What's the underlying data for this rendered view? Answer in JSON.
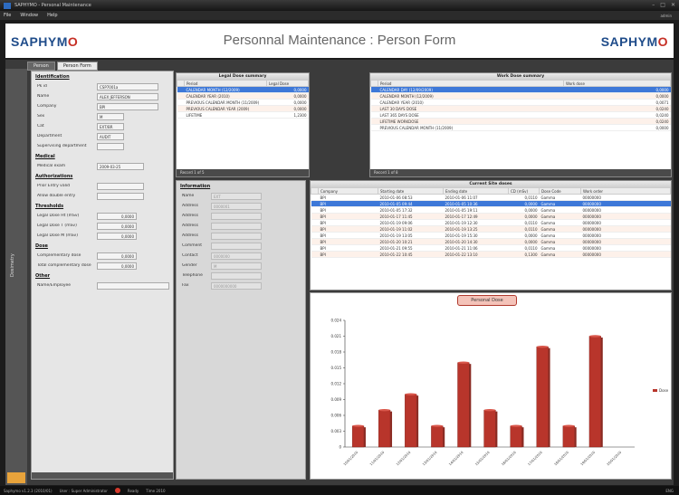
{
  "window": {
    "title": "SAPHYMO - Personal Maintenance",
    "menu": [
      "File",
      "Window",
      "Help"
    ],
    "user": "admin"
  },
  "header": {
    "logo": "SAPHYMO",
    "title": "Personnal Maintenance : Person Form"
  },
  "tabs": [
    "Person",
    "Person Form"
  ],
  "side_tab": "Dosimetry",
  "form": {
    "sections": [
      {
        "title": "Identification",
        "fields": [
          {
            "label": "Pk id",
            "value": "CSP7001a"
          },
          {
            "label": "Name",
            "value": "ALEX JEFFERSON"
          },
          {
            "label": "Company",
            "value": "BPI"
          },
          {
            "label": "Sex",
            "value": "M"
          },
          {
            "label": "Cat",
            "value": "EXT/BR"
          },
          {
            "label": "Department",
            "value": "AUDIT"
          },
          {
            "label": "Supervising department",
            "value": ""
          }
        ]
      },
      {
        "title": "Medical",
        "fields": [
          {
            "label": "Medical exam",
            "value": "2009-03-25"
          }
        ]
      },
      {
        "title": "Authorizations",
        "fields": [
          {
            "label": "Prior Entry valid",
            "value": ""
          },
          {
            "label": "Allow double entry",
            "value": ""
          }
        ]
      },
      {
        "title": "Thresholds",
        "fields": [
          {
            "label": "Legal Dose Ht (mSv)",
            "value": "0,0000"
          },
          {
            "label": "Legal Dose T (mSv)",
            "value": "0,0000"
          },
          {
            "label": "Legal Dose M (mSv)",
            "value": "0,0000"
          }
        ]
      },
      {
        "title": "Dose",
        "fields": [
          {
            "label": "Complementary dose",
            "value": "0,0000"
          },
          {
            "label": "Total complementary dose",
            "value": "0,0000"
          }
        ]
      },
      {
        "title": "Other",
        "fields": [
          {
            "label": "Name/Employee",
            "value": ""
          }
        ]
      }
    ]
  },
  "detail": {
    "title": "Information",
    "fields": [
      {
        "label": "Name",
        "value": "EXT"
      },
      {
        "label": "Address",
        "value": "0000001"
      },
      {
        "label": "Address",
        "value": ""
      },
      {
        "label": "Address",
        "value": ""
      },
      {
        "label": "Address",
        "value": ""
      },
      {
        "label": "Comment",
        "value": ""
      },
      {
        "label": "Contact",
        "value": "0000000"
      },
      {
        "label": "Gender",
        "value": "M"
      },
      {
        "label": "Telephone",
        "value": ""
      },
      {
        "label": "Fax",
        "value": "0000000000"
      }
    ]
  },
  "legal_grid": {
    "title": "Legal Dose summary",
    "columns": [
      "Period",
      "Legal Dose"
    ],
    "rows": [
      {
        "period": "CALENDAR MONTH (12/2009)",
        "dose": "0,0000",
        "selected": true
      },
      {
        "period": "CALENDAR YEAR (2010)",
        "dose": "0,0000"
      },
      {
        "period": "PREVIOUS CALENDAR MONTH (11/2009)",
        "dose": "0,0000"
      },
      {
        "period": "PREVIOUS CALENDAR YEAR (2009)",
        "dose": "0,0000"
      },
      {
        "period": "LIFETIME",
        "dose": "1,2300"
      }
    ],
    "footer": "Record 1 of 5"
  },
  "work_grid": {
    "title": "Work Dose summary",
    "columns": [
      "Period",
      "Work dose"
    ],
    "rows": [
      {
        "period": "CALENDAR DAY (12/09/2009)",
        "dose": "0,0000",
        "selected": true
      },
      {
        "period": "CALENDAR MONTH (12/2009)",
        "dose": "0,0000"
      },
      {
        "period": "CALENDAR YEAR (2010)",
        "dose": "0,0071"
      },
      {
        "period": "LAST 30 DAYS DOSE",
        "dose": "0,0240"
      },
      {
        "period": "LAST 365 DAYS DOSE",
        "dose": "0,0240"
      },
      {
        "period": "LIFETIME WORKDOSE",
        "dose": "0,0240"
      },
      {
        "period": "PREVIOUS CALENDAR MONTH (11/2009)",
        "dose": "0,0000"
      }
    ],
    "footer": "Record 1 of 8"
  },
  "sites_grid": {
    "title": "Current Site doses",
    "columns": [
      "Company",
      "Starting date",
      "Ending date",
      "CD (mSv)",
      "Dose Code",
      "Work order"
    ],
    "rows": [
      {
        "company": "BPI",
        "start": "2010-01-06 08:53",
        "end": "2010-01-06 11:07",
        "cd": "0,0110",
        "code": "Gamma",
        "wo": "00000000"
      },
      {
        "company": "BPI",
        "start": "2010-01-05 09:44",
        "end": "2010-01-05 10:36",
        "cd": "0,0000",
        "code": "Gamma",
        "wo": "00000000",
        "selected": true
      },
      {
        "company": "BPI",
        "start": "2010-01-05 17:32",
        "end": "2010-01-05 19:11",
        "cd": "0,0000",
        "code": "Gamma",
        "wo": "00000000"
      },
      {
        "company": "BPI",
        "start": "2010-01-17 11:45",
        "end": "2010-01-17 12:49",
        "cd": "0,0000",
        "code": "Gamma",
        "wo": "00000000"
      },
      {
        "company": "BPI",
        "start": "2010-01-19 09:06",
        "end": "2010-01-19 12:30",
        "cd": "0,0110",
        "code": "Gamma",
        "wo": "00000000"
      },
      {
        "company": "BPI",
        "start": "2010-01-19 11:02",
        "end": "2010-01-19 13:25",
        "cd": "0,0110",
        "code": "Gamma",
        "wo": "00000000"
      },
      {
        "company": "BPI",
        "start": "2010-01-19 13:05",
        "end": "2010-01-19 15:30",
        "cd": "0,0000",
        "code": "Gamma",
        "wo": "00000000"
      },
      {
        "company": "BPI",
        "start": "2010-01-20 10:21",
        "end": "2010-01-20 14:30",
        "cd": "0,0000",
        "code": "Gamma",
        "wo": "00000000"
      },
      {
        "company": "BPI",
        "start": "2010-01-21 09:55",
        "end": "2010-01-21 11:06",
        "cd": "0,0110",
        "code": "Gamma",
        "wo": "00000000"
      },
      {
        "company": "BPI",
        "start": "2010-01-22 10:45",
        "end": "2010-01-22 13:10",
        "cd": "0,1300",
        "code": "Gamma",
        "wo": "00000000"
      }
    ]
  },
  "chart_data": {
    "type": "bar",
    "title": "Personal Dose",
    "categories": [
      "10/01/2010",
      "11/01/2010",
      "12/01/2010",
      "13/01/2010",
      "14/01/2010",
      "15/01/2010",
      "16/01/2010",
      "17/01/2010",
      "18/01/2010",
      "19/01/2010",
      "20/01/2010"
    ],
    "values": [
      0.004,
      0.007,
      0.01,
      0.004,
      0.016,
      0.007,
      0.004,
      0.019,
      0.004,
      0.021,
      0.0
    ],
    "ylim": [
      0,
      0.024
    ],
    "yticks": [
      "0",
      "0.003",
      "0.006",
      "0.009",
      "0.012",
      "0.015",
      "0.018",
      "0.021",
      "0.024"
    ],
    "legend": "Dose",
    "bar_color": "#b8352b"
  },
  "status": {
    "left": "Saphymo v1.2.3 (2010/01)",
    "middle": "User : Super Administrator",
    "ready": "Ready",
    "time": "Time 2010",
    "right": "ENG"
  }
}
